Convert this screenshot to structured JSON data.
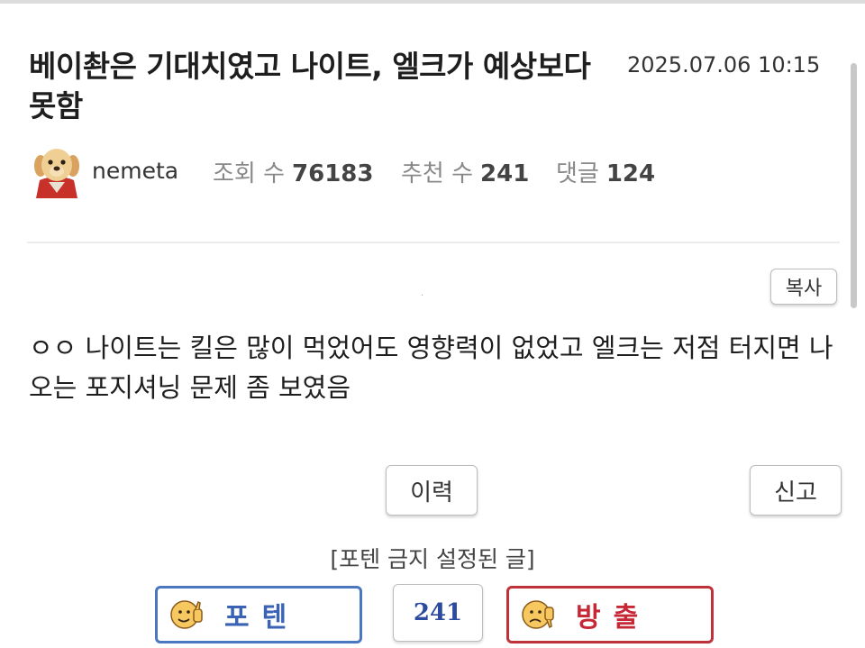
{
  "post": {
    "title": "베이촨은 기대치였고 나이트, 엘크가 예상보다 못함",
    "date": "2025.07.06 10:15",
    "author": "nemeta",
    "views_label": "조회 수",
    "views": "76183",
    "recommend_label": "추천 수",
    "recommend": "241",
    "comments_label": "댓글",
    "comments": "124",
    "body": "ㅇㅇ 나이트는 킬은 많이 먹었어도 영향력이 없었고 엘크는 저점 터지면 나오는 포지셔닝 문제 좀 보였음"
  },
  "buttons": {
    "copy": "복사",
    "history": "이력",
    "report": "신고"
  },
  "vote": {
    "notice": "[포텐 금지 설정된 글]",
    "up_label": "포텐",
    "count": "241",
    "down_label": "방출"
  },
  "colors": {
    "up_border": "#4a77c0",
    "down_border": "#c0323a",
    "count_text": "#2c4a9e"
  },
  "icons": [
    "avatar-dog-icon",
    "thumbs-up-face-icon",
    "thumbs-down-face-icon"
  ]
}
